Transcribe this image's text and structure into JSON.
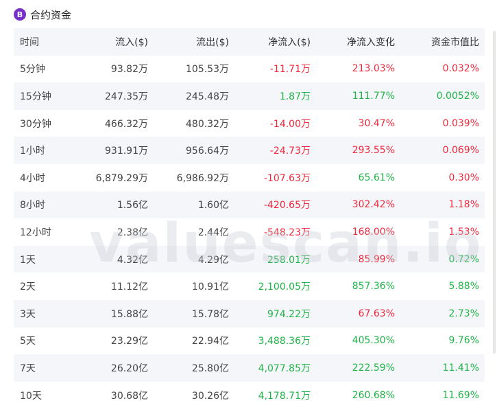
{
  "header": {
    "logo_letter": "B",
    "title": "合约资金"
  },
  "watermark": "valuescan.io",
  "table": {
    "columns": [
      "时间",
      "流入($)",
      "流出($)",
      "净流入($)",
      "净流入变化",
      "资金市值比"
    ],
    "rows": [
      {
        "period": "5分钟",
        "inflow": "93.82万",
        "outflow": "105.53万",
        "net": "-11.71万",
        "net_color": "red",
        "change": "213.03%",
        "change_color": "red",
        "ratio": "0.032%",
        "ratio_color": "red"
      },
      {
        "period": "15分钟",
        "inflow": "247.35万",
        "outflow": "245.48万",
        "net": "1.87万",
        "net_color": "green",
        "change": "111.77%",
        "change_color": "green",
        "ratio": "0.0052%",
        "ratio_color": "green"
      },
      {
        "period": "30分钟",
        "inflow": "466.32万",
        "outflow": "480.32万",
        "net": "-14.00万",
        "net_color": "red",
        "change": "30.47%",
        "change_color": "red",
        "ratio": "0.039%",
        "ratio_color": "red"
      },
      {
        "period": "1小时",
        "inflow": "931.91万",
        "outflow": "956.64万",
        "net": "-24.73万",
        "net_color": "red",
        "change": "293.55%",
        "change_color": "red",
        "ratio": "0.069%",
        "ratio_color": "red"
      },
      {
        "period": "4小时",
        "inflow": "6,879.29万",
        "outflow": "6,986.92万",
        "net": "-107.63万",
        "net_color": "red",
        "change": "65.61%",
        "change_color": "green",
        "ratio": "0.30%",
        "ratio_color": "red"
      },
      {
        "period": "8小时",
        "inflow": "1.56亿",
        "outflow": "1.60亿",
        "net": "-420.65万",
        "net_color": "red",
        "change": "302.42%",
        "change_color": "red",
        "ratio": "1.18%",
        "ratio_color": "red"
      },
      {
        "period": "12小时",
        "inflow": "2.38亿",
        "outflow": "2.44亿",
        "net": "-548.23万",
        "net_color": "red",
        "change": "168.00%",
        "change_color": "red",
        "ratio": "1.53%",
        "ratio_color": "red"
      },
      {
        "period": "1天",
        "inflow": "4.32亿",
        "outflow": "4.29亿",
        "net": "258.01万",
        "net_color": "green",
        "change": "85.99%",
        "change_color": "red",
        "ratio": "0.72%",
        "ratio_color": "green"
      },
      {
        "period": "2天",
        "inflow": "11.12亿",
        "outflow": "10.91亿",
        "net": "2,100.05万",
        "net_color": "green",
        "change": "857.36%",
        "change_color": "green",
        "ratio": "5.88%",
        "ratio_color": "green"
      },
      {
        "period": "3天",
        "inflow": "15.88亿",
        "outflow": "15.78亿",
        "net": "974.22万",
        "net_color": "green",
        "change": "67.63%",
        "change_color": "red",
        "ratio": "2.73%",
        "ratio_color": "green"
      },
      {
        "period": "5天",
        "inflow": "23.29亿",
        "outflow": "22.94亿",
        "net": "3,488.36万",
        "net_color": "green",
        "change": "405.30%",
        "change_color": "green",
        "ratio": "9.76%",
        "ratio_color": "green"
      },
      {
        "period": "7天",
        "inflow": "26.20亿",
        "outflow": "25.80亿",
        "net": "4,077.85万",
        "net_color": "green",
        "change": "222.59%",
        "change_color": "green",
        "ratio": "11.41%",
        "ratio_color": "green"
      },
      {
        "period": "10天",
        "inflow": "30.68亿",
        "outflow": "30.26亿",
        "net": "4,178.71万",
        "net_color": "green",
        "change": "260.68%",
        "change_color": "green",
        "ratio": "11.69%",
        "ratio_color": "green"
      }
    ]
  }
}
